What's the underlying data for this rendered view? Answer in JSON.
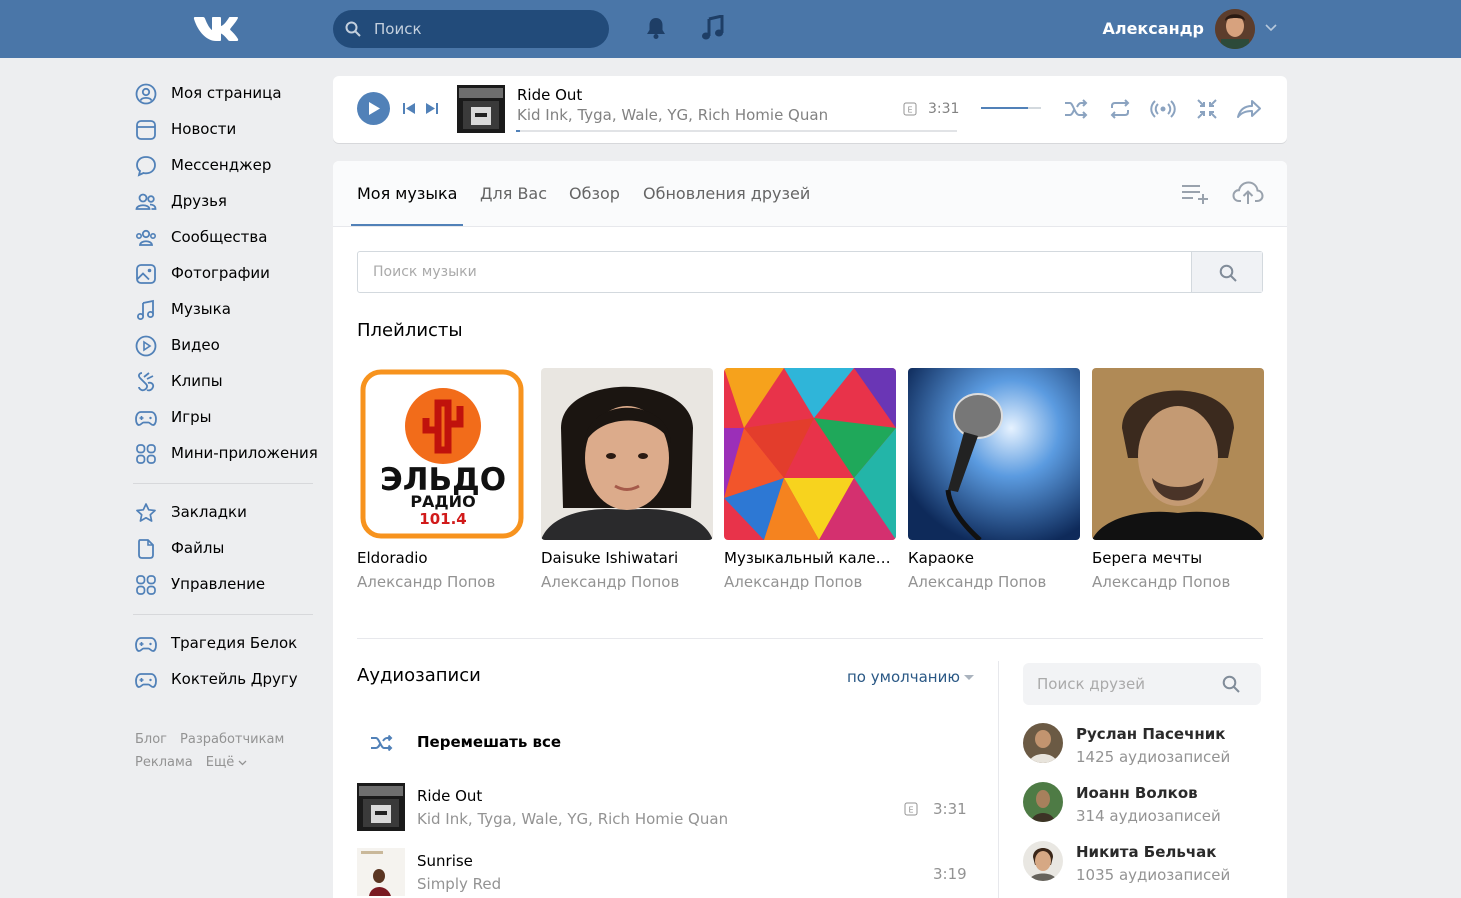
{
  "header": {
    "search_placeholder": "Поиск",
    "user_name": "Александр"
  },
  "sidebar": {
    "items": [
      {
        "label": "Моя страница",
        "icon": "user-circle-icon"
      },
      {
        "label": "Новости",
        "icon": "newsfeed-icon"
      },
      {
        "label": "Мессенджер",
        "icon": "message-icon"
      },
      {
        "label": "Друзья",
        "icon": "friends-icon"
      },
      {
        "label": "Сообщества",
        "icon": "communities-icon"
      },
      {
        "label": "Фотографии",
        "icon": "photo-icon"
      },
      {
        "label": "Музыка",
        "icon": "music-icon"
      },
      {
        "label": "Видео",
        "icon": "video-icon"
      },
      {
        "label": "Клипы",
        "icon": "clips-icon"
      },
      {
        "label": "Игры",
        "icon": "gamepad-icon"
      },
      {
        "label": "Мини-приложения",
        "icon": "apps-icon"
      }
    ],
    "items2": [
      {
        "label": "Закладки",
        "icon": "star-icon"
      },
      {
        "label": "Файлы",
        "icon": "file-icon"
      },
      {
        "label": "Управление",
        "icon": "apps-icon"
      }
    ],
    "items3": [
      {
        "label": "Трагедия Белок",
        "icon": "gamepad-icon"
      },
      {
        "label": "Коктейль Другу",
        "icon": "gamepad-icon"
      }
    ],
    "footer": [
      "Блог",
      "Разработчикам",
      "Реклама",
      "Ещё"
    ]
  },
  "player": {
    "title": "Ride Out",
    "artist": "Kid Ink, Tyga, Wale, YG, Rich Homie Quan",
    "explicit_badge": "E",
    "time": "3:31",
    "progress": 0.01,
    "volume": 0.78
  },
  "tabs": [
    "Моя музыка",
    "Для Вас",
    "Обзор",
    "Обновления друзей"
  ],
  "music_search_placeholder": "Поиск музыки",
  "playlists_heading": "Плейлисты",
  "playlists": [
    {
      "title": "Eldoradio",
      "author": "Александр Попов",
      "cover_text": [
        "ЭЛЬДО",
        "РАДИО",
        "101.4"
      ]
    },
    {
      "title": "Daisuke Ishiwatari",
      "author": "Александр Попов"
    },
    {
      "title": "Музыкальный калейдоскоп",
      "author": "Александр Попов"
    },
    {
      "title": "Караоке",
      "author": "Александр Попов"
    },
    {
      "title": "Берега мечты",
      "author": "Александр Попов"
    }
  ],
  "audio_heading": "Аудиозаписи",
  "sort_label": "по умолчанию",
  "shuffle_all_label": "Перемешать все",
  "tracks": [
    {
      "title": "Ride Out",
      "artist": "Kid Ink, Tyga, Wale, YG, Rich Homie Quan",
      "explicit": "E",
      "duration": "3:31"
    },
    {
      "title": "Sunrise",
      "artist": "Simply Red",
      "duration": "3:19"
    }
  ],
  "friends_search_placeholder": "Поиск друзей",
  "friends": [
    {
      "name": "Руслан Пасечник",
      "count": "1425 аудиозаписей"
    },
    {
      "name": "Иоанн Волков",
      "count": "314 аудиозаписей"
    },
    {
      "name": "Никита Бельчак",
      "count": "1035 аудиозаписей"
    }
  ],
  "colors": {
    "header": "#4a76a8",
    "accent": "#5181b8",
    "link": "#2a5885"
  }
}
